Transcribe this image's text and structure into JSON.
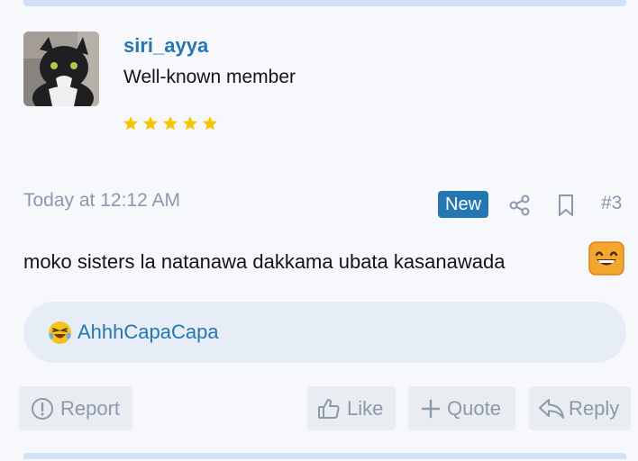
{
  "user": {
    "username": "siri_ayya",
    "title": "Well-known member",
    "star_rating": 5
  },
  "post": {
    "timestamp": "Today at 12:12 AM",
    "badge": "New",
    "number": "#3",
    "message": "moko sisters la natanawa dakkama ubata kasanawada",
    "message_emoji": "grinning-face-smiling-eyes"
  },
  "reactions": {
    "emoji": "rolling-on-floor-laughing",
    "users": "AhhhCapaCapa"
  },
  "actions": {
    "report": "Report",
    "like": "Like",
    "quote": "Quote",
    "reply": "Reply"
  },
  "colors": {
    "accent": "#2577b1",
    "muted": "#8c98ac",
    "star": "#f5c600",
    "reaction_bg": "#e6edf7",
    "button_bg": "#e9edf2"
  }
}
